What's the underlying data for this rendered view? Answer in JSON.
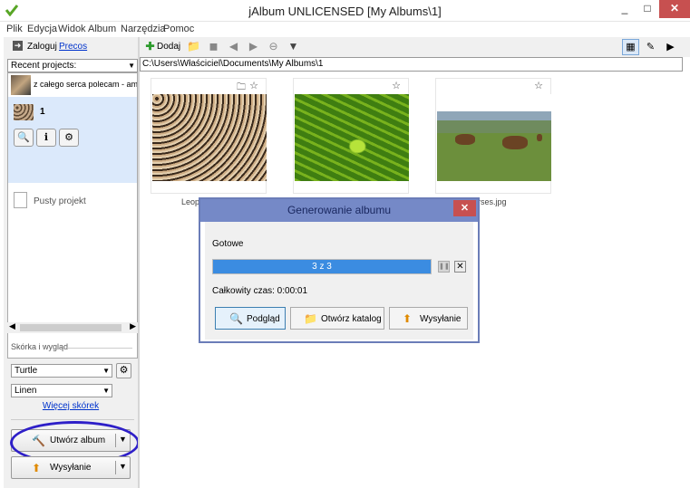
{
  "window": {
    "title": "jAlbum UNLICENSED [My Albums\\1]",
    "min": "_",
    "max": "□",
    "close": "✕"
  },
  "menu": [
    "Plik",
    "Edycja",
    "Widok",
    "Album",
    "Narzędzia",
    "Pomoc"
  ],
  "login": {
    "label": "Zaloguj",
    "link": "Precos"
  },
  "recent": {
    "label": "Recent projects:"
  },
  "projects": [
    {
      "name": "z całego serca polecam - amba"
    },
    {
      "name": "1"
    }
  ],
  "new_project": "Pusty projekt",
  "skin": {
    "heading": "Skórka i wygląd",
    "skin_value": "Turtle",
    "style_value": "Linen",
    "more_link": "Więcej skórek"
  },
  "actions": {
    "make_album": "Utwórz album",
    "upload": "Wysyłanie"
  },
  "toolbar": {
    "add_label": "Dodaj"
  },
  "path": "C:\\Users\\Właściciel\\Documents\\My Albums\\1",
  "images": [
    {
      "caption": "Leop"
    },
    {
      "caption": ""
    },
    {
      "caption": "orses.jpg"
    }
  ],
  "dialog": {
    "title": "Generowanie albumu",
    "status": "Gotowe",
    "progress_text": "3 z 3",
    "progress": 1.0,
    "total_time": "Całkowity czas: 0:00:01",
    "buttons": {
      "preview": "Podgląd",
      "open_folder": "Otwórz katalog",
      "upload": "Wysyłanie"
    }
  },
  "colors": {
    "accent": "#3b8ce1",
    "highlight": "#2e1fc8",
    "dialog_title": "#7589c7",
    "close_red": "#c75050"
  }
}
